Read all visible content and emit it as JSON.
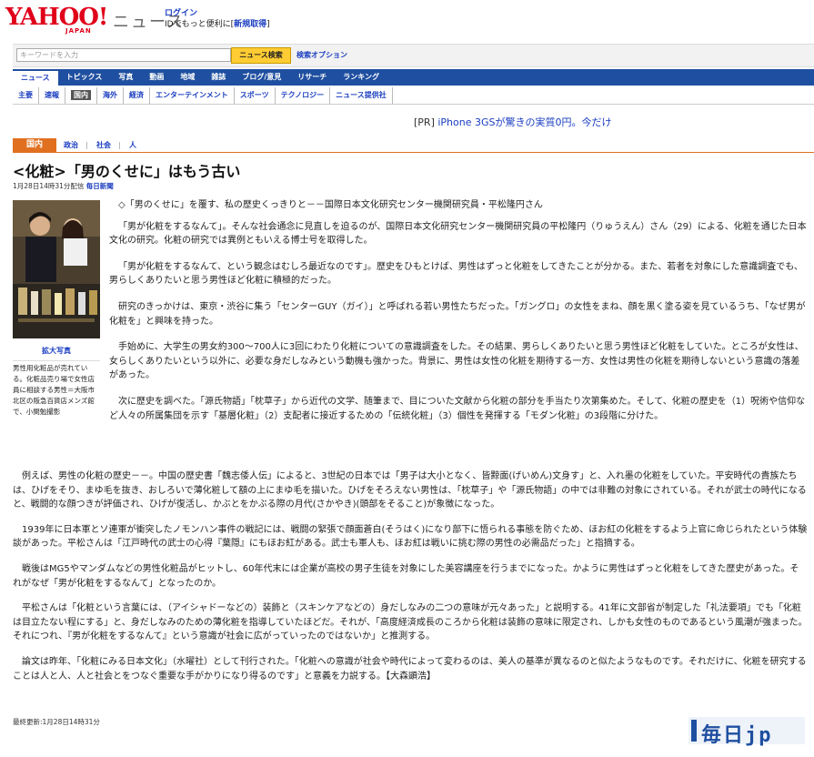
{
  "header": {
    "logo_text": "YAHOO!",
    "logo_sub": "JAPAN",
    "section_title": "ニュース",
    "login_label": "ログイン",
    "login_note_prefix": "IDでもっと便利に[",
    "login_register": "新規取得",
    "login_note_suffix": "]"
  },
  "search": {
    "placeholder": "キーワードを入力",
    "button_label": "ニュース検索",
    "options_label": "検索オプション"
  },
  "main_tabs": [
    "ニュース",
    "トピックス",
    "写真",
    "動画",
    "地域",
    "雑誌",
    "ブログ/意見",
    "リサーチ",
    "ランキング"
  ],
  "sub_tabs": [
    "主要",
    "速報",
    "国内",
    "海外",
    "経済",
    "エンターテインメント",
    "スポーツ",
    "テクノロジー",
    "ニュース提供社"
  ],
  "sub_tab_active": "国内",
  "pr": {
    "tag": "[PR]",
    "text": "iPhone 3GSが驚きの実質0円。今だけ"
  },
  "category": {
    "active": "国内",
    "links": [
      "政治",
      "社会",
      "人"
    ],
    "separators": "|"
  },
  "article": {
    "headline": "<化粧>「男のくせに」はもう古い",
    "date": "1月28日14時31分配信",
    "source": "毎日新聞",
    "photo_credit": "拡大写真",
    "photo_caption": "男性用化粧品が売れている。化粧品売り場で女性店員に相談する男性＝大阪市北区の阪急百貨店メンズ館で、小関勉撮影",
    "paragraphs": [
      "◇「男のくせに」を覆す、私の歴史くっきりと－－国際日本文化研究センター機関研究員・平松隆円さん",
      "「男が化粧をするなんて」。そんな社会通念に見直しを迫るのが、国際日本文化研究センター機関研究員の平松隆円（りゅうえん）さん（29）による、化粧を通じた日本文化の研究。化粧の研究では異例ともいえる博士号を取得した。",
      "「男が化粧をするなんて、という観念はむしろ最近なのです」。歴史をひもとけば、男性はずっと化粧をしてきたことが分かる。また、若者を対象にした意識調査でも、男らしくありたいと思う男性ほど化粧に積極的だった。",
      "研究のきっかけは、東京・渋谷に集う「センターGUY（ガイ）」と呼ばれる若い男性たちだった。「ガングロ」の女性をまね、顔を黒く塗る姿を見ているうち、「なぜ男が化粧を」と興味を持った。",
      "手始めに、大学生の男女約300～700人に3回にわたり化粧についての意識調査をした。その結果、男らしくありたいと思う男性ほど化粧をしていた。ところが女性は、女らしくありたいという以外に、必要な身だしなみという動機も強かった。背景に、男性は女性の化粧を期待する一方、女性は男性の化粧を期待しないという意識の落差があった。",
      "次に歴史を調べた。「源氏物語」「枕草子」から近代の文学、随筆まで、目についた文献から化粧の部分を手当たり次第集めた。そして、化粧の歴史を（1）呪術や信仰など人々の所属集団を示す「基層化粧」（2）支配者に接近するための「伝統化粧」（3）個性を発揮する「モダン化粧」の3段階に分けた。"
    ],
    "paragraphs_full": [
      "例えば、男性の化粧の歴史－－。中国の歴史書「魏志倭人伝」によると、3世紀の日本では「男子は大小となく、皆黥面(げいめん)文身す」と、入れ墨の化粧をしていた。平安時代の貴族たちは、ひげをそり、まゆ毛を抜き、おしろいで薄化粧して額の上にまゆ毛を描いた。ひげをそろえない男性は、「枕草子」や「源氏物語」の中では非難の対象にされている。それが武士の時代になると、戦闘的な顔つきが評価され、ひげが復活し、かぶとをかぶる際の月代(さかやき)(頭部をそること)が象徴になった。",
      "1939年に日本軍とソ連軍が衝突したノモンハン事件の戦記には、戦闘の緊張で顔面蒼白(そうはく)になり部下に悟られる事態を防ぐため、ほお紅の化粧をするよう上官に命じられたという体験談があった。平松さんは「江戸時代の武士の心得『葉隠』にもほお紅がある。武士も軍人も、ほお紅は戦いに挑む際の男性の必需品だった」と指摘する。",
      "戦後はMG5やマンダムなどの男性化粧品がヒットし、60年代末には企業が高校の男子生徒を対象にした美容講座を行うまでになった。かように男性はずっと化粧をしてきた歴史があった。それがなぜ「男が化粧をするなんて」となったのか。",
      "平松さんは「化粧という言葉には、（アイシャドーなどの）装飾と（スキンケアなどの）身だしなみの二つの意味が元々あった」と説明する。41年に文部省が制定した「礼法要項」でも「化粧は目立たない程にする」と、身だしなみのための薄化粧を指導していたほどだ。それが、「高度経済成長のころから化粧は装飾の意味に限定され、しかも女性のものであるという風潮が強まった。それにつれ、『男が化粧をするなんて』という意識が社会に広がっていったのではないか」と推測する。",
      "論文は昨年、「化粧にみる日本文化」（水曜社）として刊行された。「化粧への意識が社会や時代によって変わるのは、美人の基準が異なるのと似たようなものです。それだけに、化粧を研究することは人と人、人と社会とをつなぐ重要な手がかりになり得るのです」と意義を力説する。【大森顕浩】"
    ],
    "last_updated": "最終更新:1月28日14時31分"
  },
  "footer_logo": "毎日jp"
}
